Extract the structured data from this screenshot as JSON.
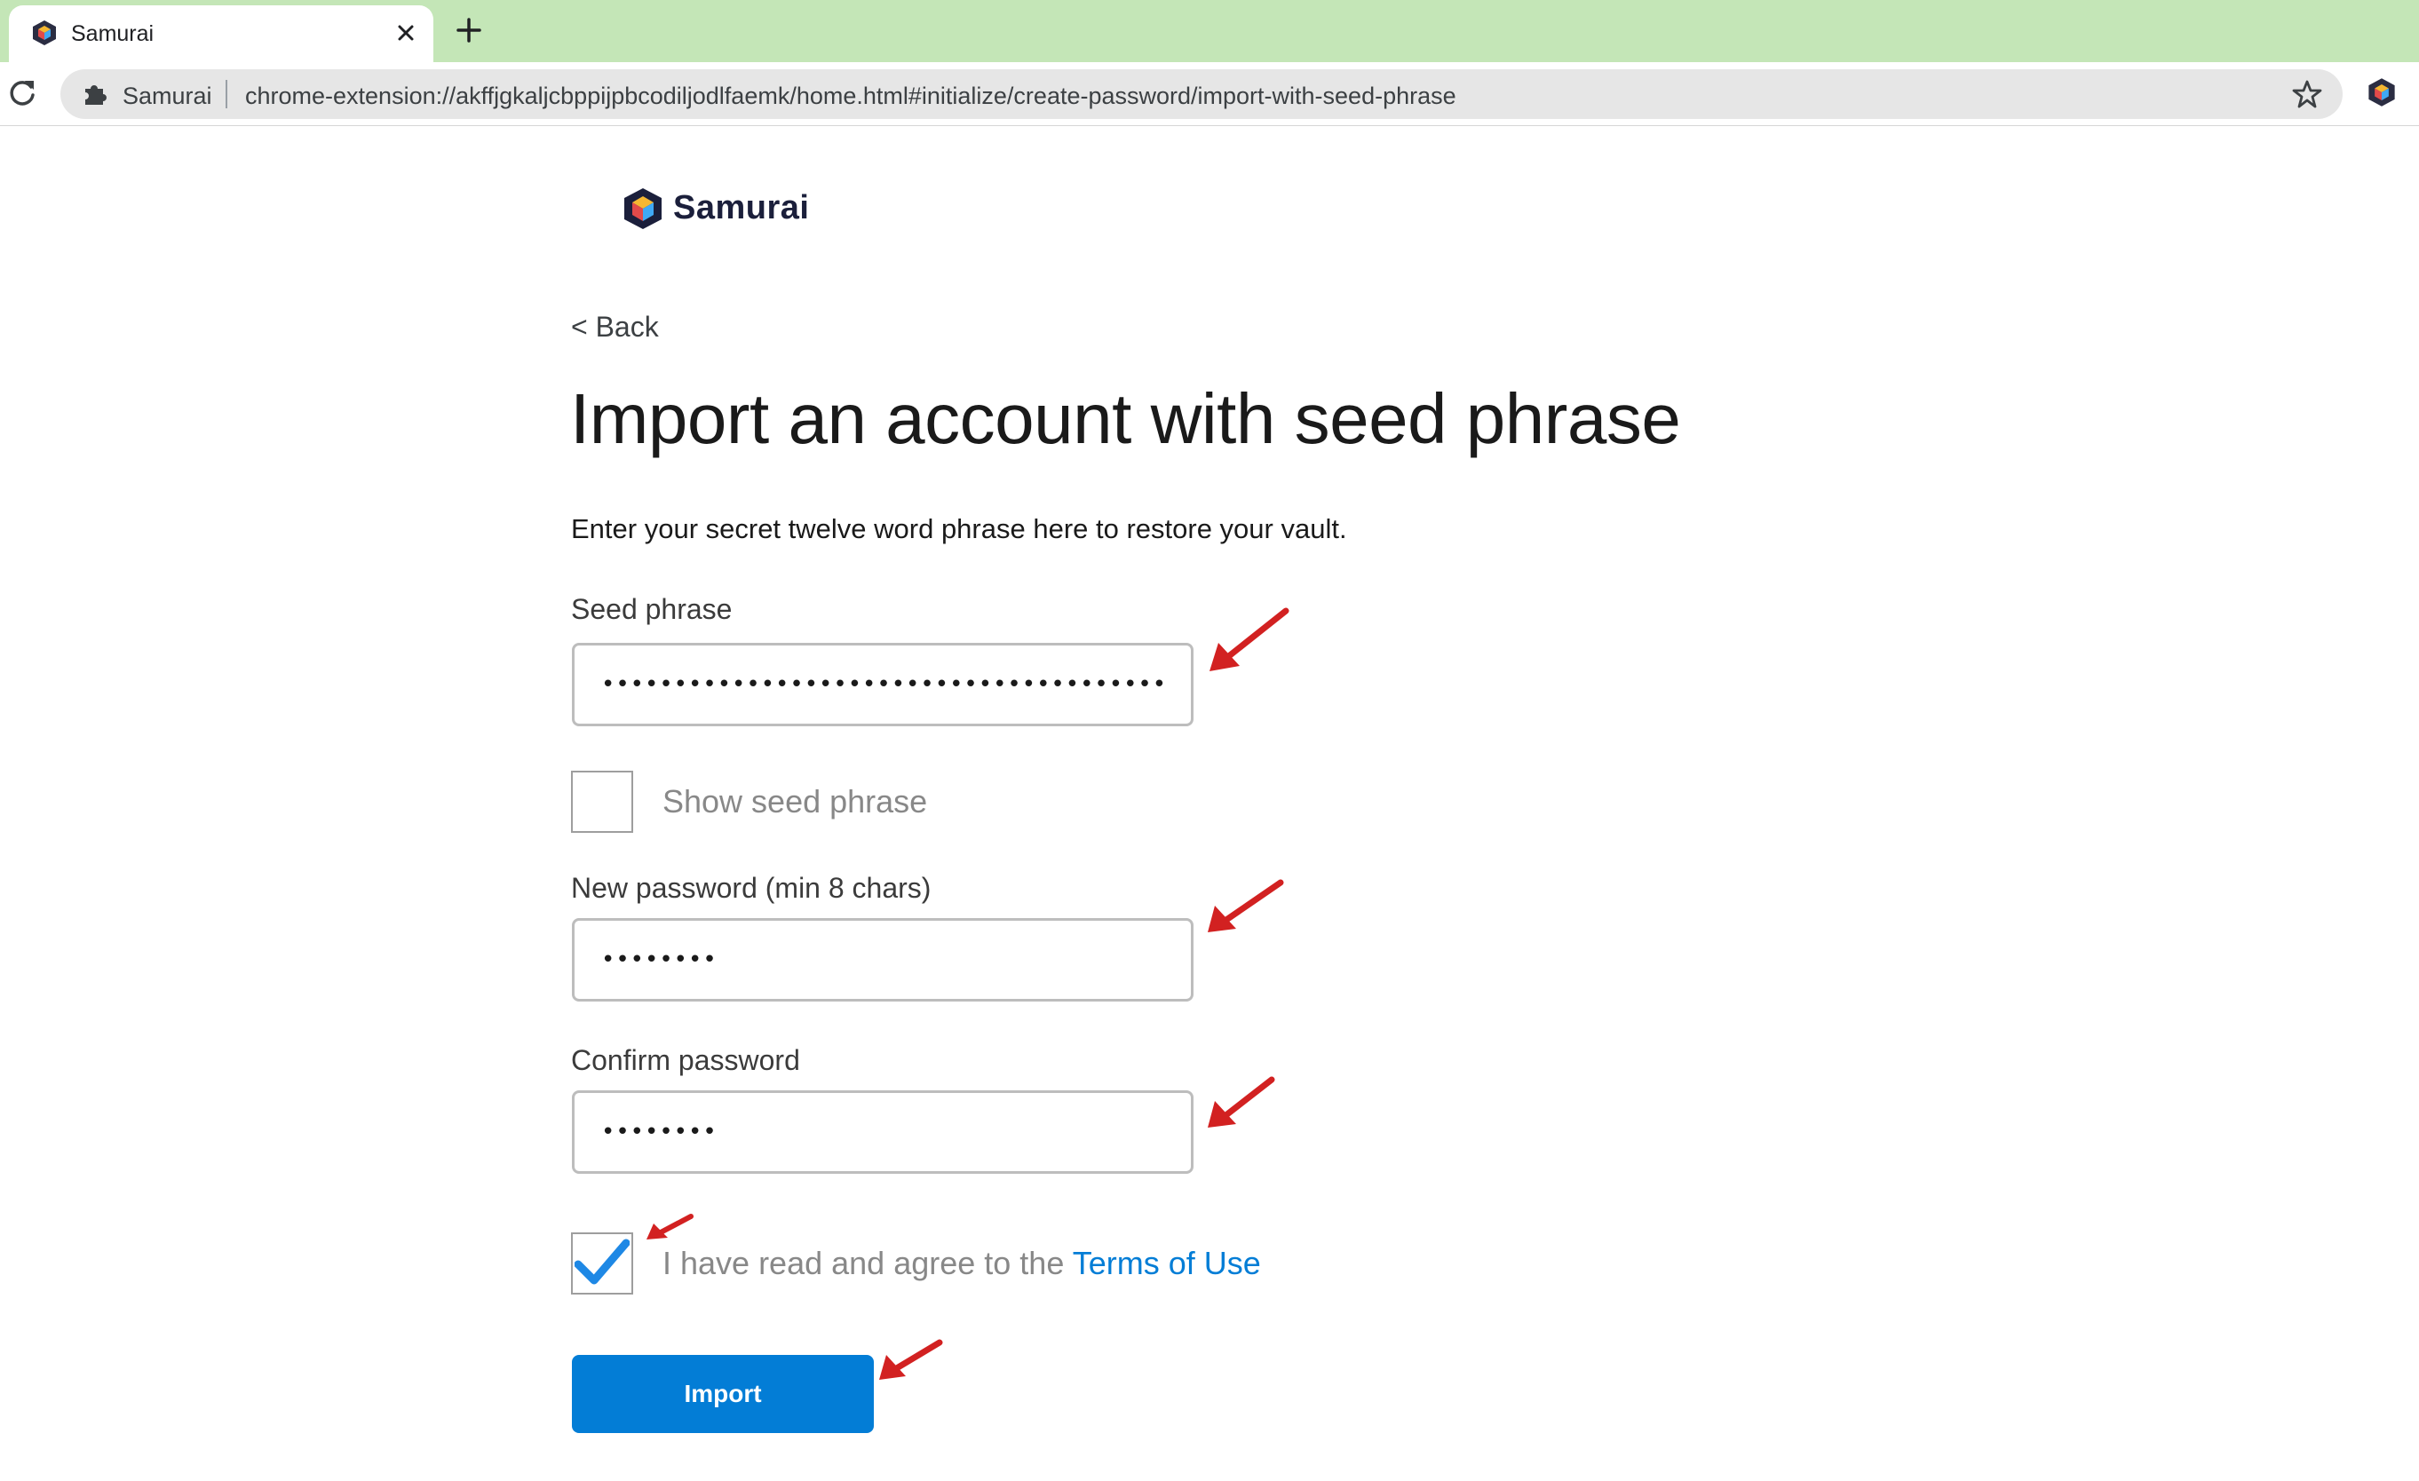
{
  "browser": {
    "tab_title": "Samurai",
    "omnibox_extension_name": "Samurai",
    "url": "chrome-extension://akffjgkaljcbppijpbcodiljodlfaemk/home.html#initialize/create-password/import-with-seed-phrase",
    "tabbar_color": "#c4e6b7"
  },
  "header": {
    "brand_name": "Samurai"
  },
  "page": {
    "back_link": "< Back",
    "title": "Import an account with seed phrase",
    "subtitle": "Enter your secret twelve word phrase here to restore your vault."
  },
  "form": {
    "seed_phrase": {
      "label": "Seed phrase",
      "value": "•••••••••••••••••••••••••••••••••••••••••••••••••••••••"
    },
    "show_seed_phrase": {
      "label": "Show seed phrase",
      "checked": false
    },
    "new_password": {
      "label": "New password (min 8 chars)",
      "value": "••••••••"
    },
    "confirm_password": {
      "label": "Confirm password",
      "value": "••••••••"
    },
    "terms": {
      "checked": true,
      "label_prefix": "I have read and agree to the ",
      "link_text": "Terms of Use"
    },
    "import_button": "Import"
  },
  "colors": {
    "primary": "#037dd6",
    "annotation_arrow": "#d22121",
    "checkmark": "#1e88e5"
  },
  "icons": {
    "tab_favicon": "samurai-cube-icon",
    "tab_close": "close-icon",
    "new_tab": "plus-icon",
    "reload": "reload-icon",
    "omnibox_extension": "puzzle-piece-icon",
    "bookmark": "star-icon",
    "toolbar_extension": "samurai-cube-icon",
    "logo": "samurai-cube-icon",
    "terms_checkmark": "checkmark-icon",
    "annotations": "red-arrow-icon"
  }
}
